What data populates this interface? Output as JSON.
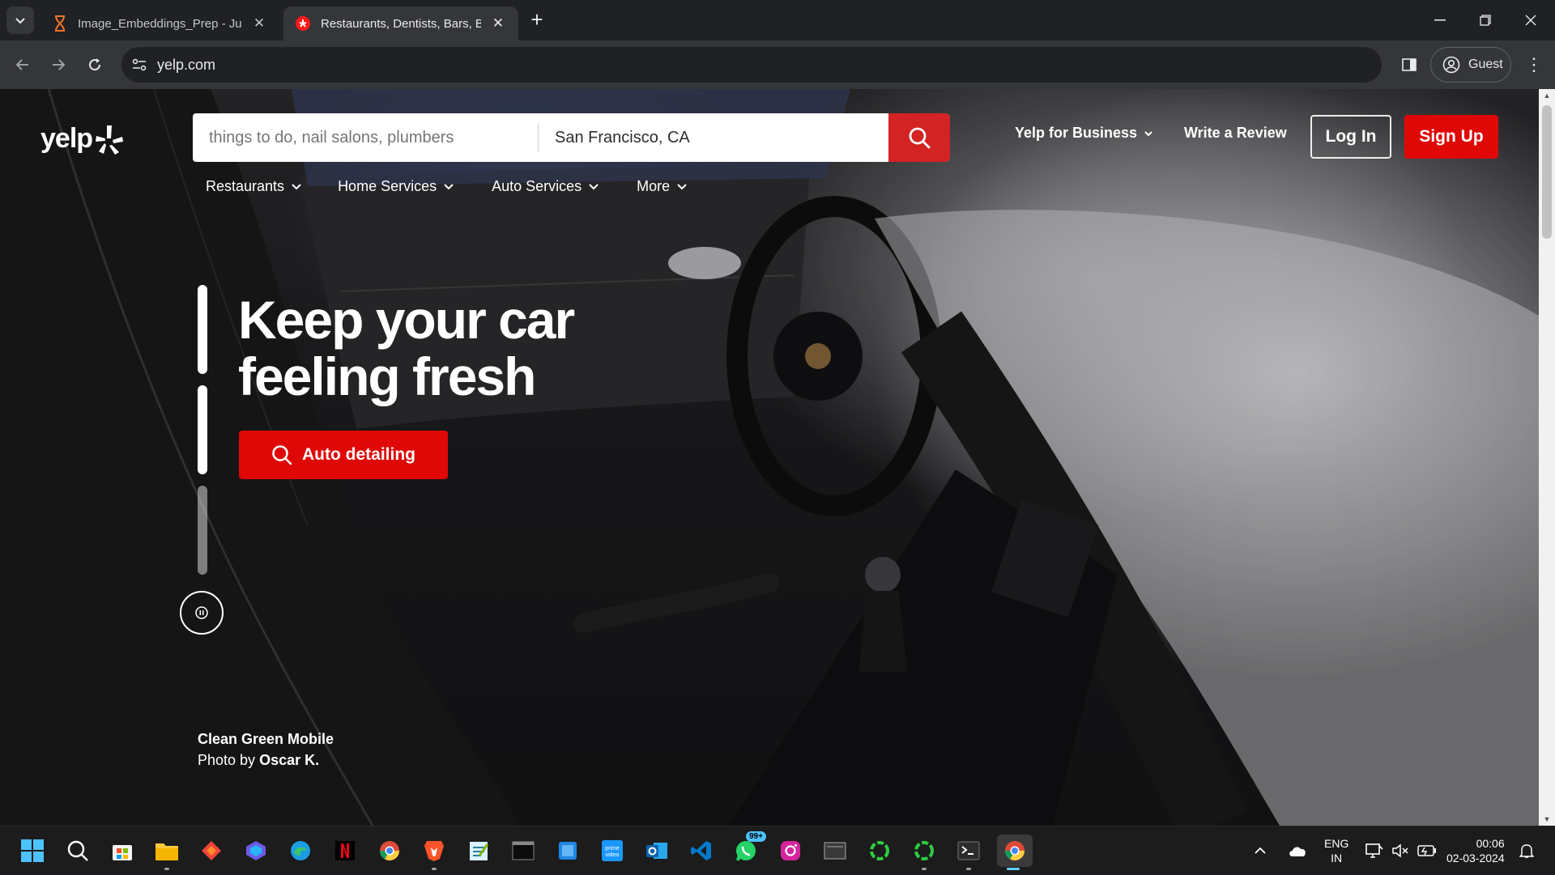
{
  "browser": {
    "tabs": [
      {
        "title": "Image_Embeddings_Prep - Jupyter",
        "active": false,
        "favicon": "hourglass-icon"
      },
      {
        "title": "Restaurants, Dentists, Bars, Beauty",
        "active": true,
        "favicon": "yelp-icon"
      }
    ],
    "url": "yelp.com",
    "profile_label": "Guest"
  },
  "yelp": {
    "logo_text": "yelp",
    "search": {
      "find_placeholder": "things to do, nail salons, plumbers",
      "near_value": "San Francisco, CA"
    },
    "header": {
      "business_label": "Yelp for Business",
      "review_label": "Write a Review",
      "login_label": "Log In",
      "signup_label": "Sign Up"
    },
    "categories": [
      {
        "label": "Restaurants"
      },
      {
        "label": "Home Services"
      },
      {
        "label": "Auto Services"
      },
      {
        "label": "More"
      }
    ],
    "hero": {
      "title": "Keep your car feeling fresh",
      "cta_label": "Auto detailing",
      "slides_total": 3,
      "active_slide": 2
    },
    "credit": {
      "business": "Clean Green Mobile",
      "photo_prefix": "Photo by",
      "photographer": "Oscar K."
    },
    "colors": {
      "brand_red": "#e00707",
      "search_red": "#d32323"
    }
  },
  "taskbar": {
    "icons": [
      "windows-start-icon",
      "search-icon",
      "microsoft-store-icon",
      "file-explorer-icon",
      "anydesk-icon",
      "copilot-icon",
      "edge-icon",
      "netflix-icon",
      "chrome-icon",
      "brave-icon",
      "notepad-icon",
      "terminal-icon",
      "settings-icon",
      "prime-video-icon",
      "outlook-icon",
      "vscode-icon",
      "whatsapp-icon",
      "instagram-icon",
      "window-app-icon",
      "refresh-app-icon",
      "refresh-app-icon-2",
      "powershell-icon",
      "chrome-active-icon"
    ],
    "whatsapp_badge": "99+",
    "language": "ENG",
    "region": "IN",
    "time": "00:06",
    "date": "02-03-2024"
  }
}
